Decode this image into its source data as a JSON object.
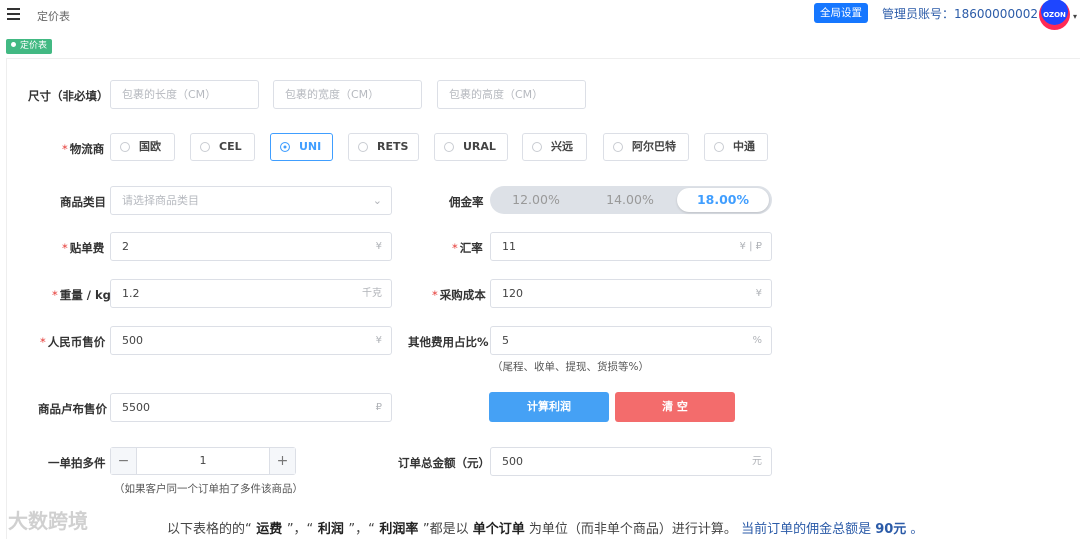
{
  "header": {
    "breadcrumb": "定价表",
    "global_settings": "全局设置",
    "admin_account": "管理员账号：18600000002",
    "avatar_text": "OZON"
  },
  "tag": {
    "label": "定价表"
  },
  "form": {
    "size": {
      "label": "尺寸（非必填）",
      "length_placeholder": "包裹的长度（CM）",
      "width_placeholder": "包裹的宽度（CM）",
      "height_placeholder": "包裹的高度（CM）"
    },
    "carrier": {
      "label": "物流商",
      "options": [
        "国欧",
        "CEL",
        "UNI",
        "RETS",
        "URAL",
        "兴远",
        "阿尔巴特",
        "中通"
      ],
      "selected": "UNI"
    },
    "category": {
      "label": "商品类目",
      "placeholder": "请选择商品类目"
    },
    "commission": {
      "label": "佣金率",
      "options": [
        "12.00%",
        "14.00%",
        "18.00%"
      ],
      "selected": "18.00%"
    },
    "label_fee": {
      "label": "贴单费",
      "value": "2",
      "suffix": "¥"
    },
    "exchange_rate": {
      "label": "汇率",
      "value": "11",
      "suffix": "¥ | ₽"
    },
    "weight": {
      "label": "重量 / kg",
      "value": "1.2",
      "suffix": "千克"
    },
    "purchase_cost": {
      "label": "采购成本",
      "value": "120",
      "suffix": "¥"
    },
    "rmb_price": {
      "label": "人民币售价",
      "value": "500",
      "suffix": "¥"
    },
    "other_fee": {
      "label": "其他费用占比%",
      "value": "5",
      "suffix": "%",
      "hint": "（尾程、收单、提现、货损等%）"
    },
    "rub_price": {
      "label": "商品卢布售价",
      "value": "5500",
      "suffix": "₽"
    },
    "calc_button": "计算利润",
    "clear_button": "清 空",
    "multi": {
      "label": "一单拍多件",
      "minus": "−",
      "value": "1",
      "plus": "+",
      "hint": "（如果客户同一个订单拍了多件该商品）"
    },
    "order_total": {
      "label": "订单总金额（元）",
      "value": "500",
      "suffix": "元"
    }
  },
  "footer": {
    "part1": "以下表格的的“",
    "shipping": " 运费 ",
    "part2": "”，“",
    "profit": " 利润 ",
    "part3": "”，“",
    "profit_rate": " 利润率 ",
    "part4": "”都是以 ",
    "single_order": "单个订单",
    "part5": " 为单位（而非单个商品）进行计算。",
    "commission_prefix": " 当前订单的佣金总额是 ",
    "commission_total": "90元",
    "commission_suffix": " 。"
  },
  "watermark": "大数跨境"
}
